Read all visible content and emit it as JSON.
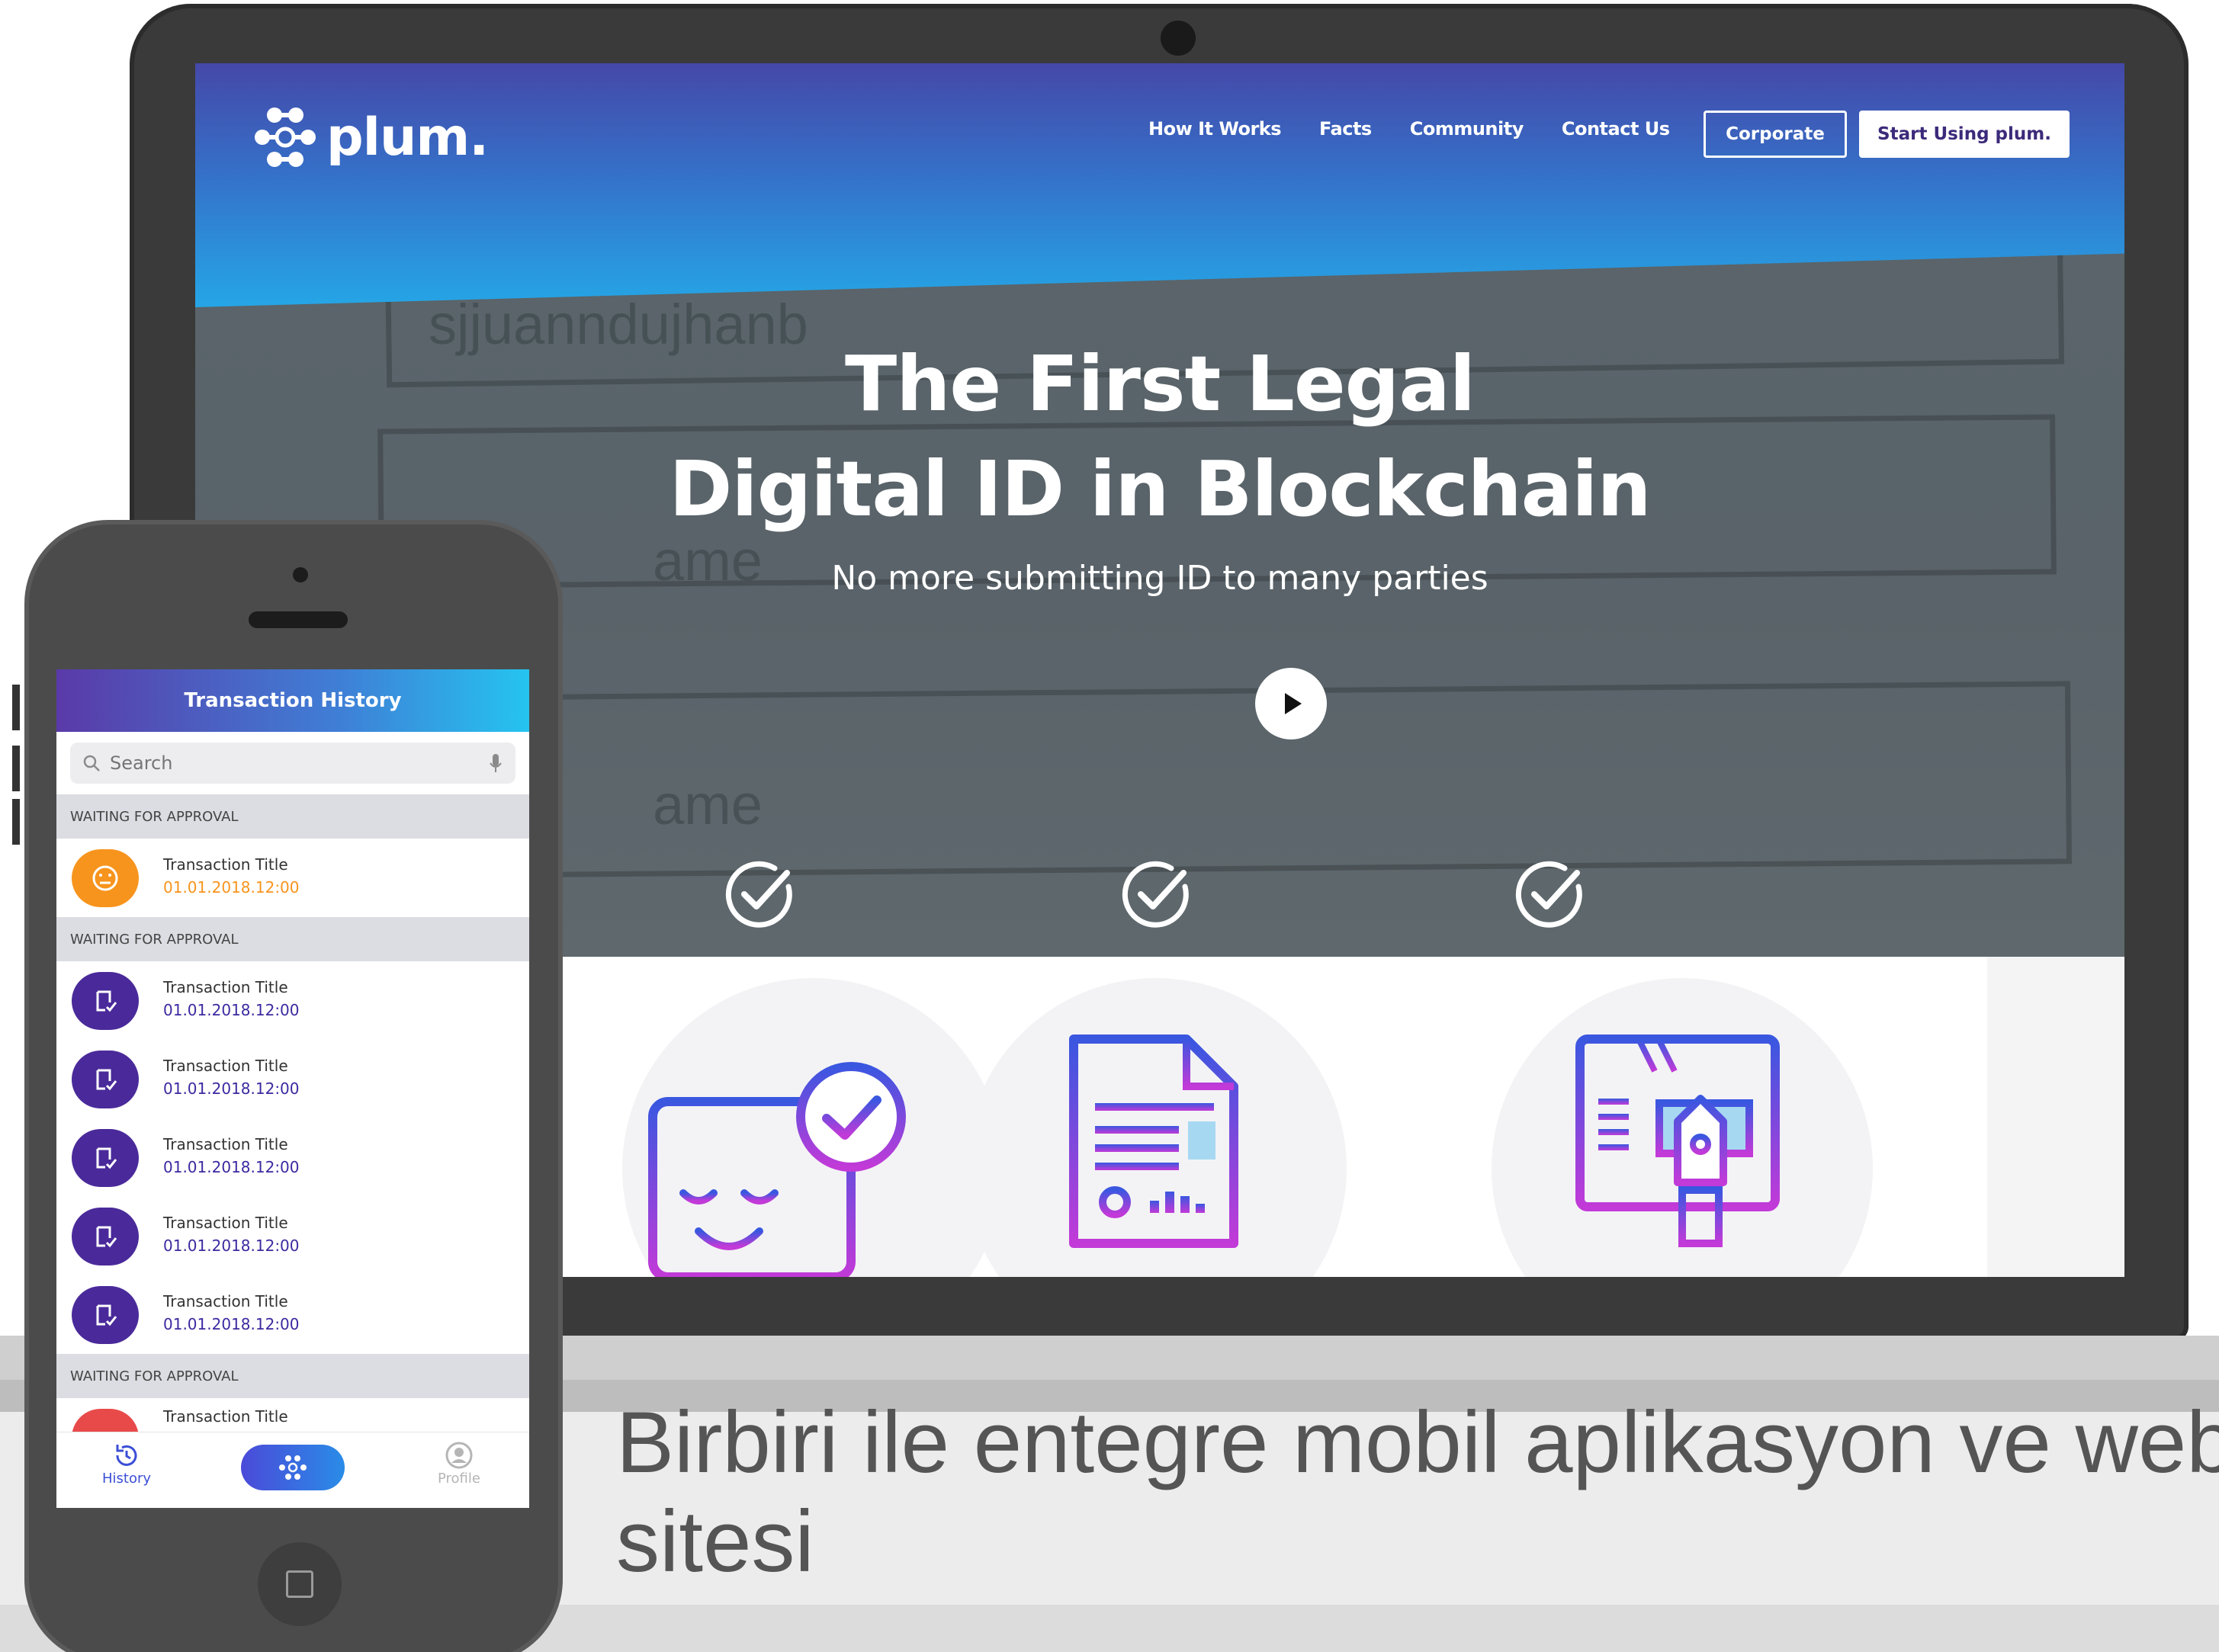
{
  "website": {
    "brand": "plum.",
    "nav": [
      "How It Works",
      "Facts",
      "Community",
      "Contact Us"
    ],
    "corporate_label": "Corporate",
    "start_label": "Start Using plum.",
    "hero": {
      "title_line1": "The First Legal",
      "title_line2": "Digital ID in Blockchain",
      "subtitle": "No more submitting ID to many parties"
    },
    "background_form_words": [
      "sjjuanndujhanb",
      "ame",
      "ame"
    ],
    "colors": {
      "nav_start": "#4548a8",
      "nav_end": "#25a6e6",
      "brand_purple": "#3c2a7a"
    },
    "icons": [
      "play-icon",
      "check-circle-icon",
      "check-circle-icon",
      "check-circle-icon",
      "verified-face-icon",
      "document-icon",
      "certificate-pen-icon"
    ]
  },
  "app": {
    "header_title": "Transaction History",
    "search_placeholder": "Search",
    "sections": [
      {
        "label": "WAITING FOR APPROVAL"
      },
      {
        "label": "WAITING FOR APPROVAL"
      },
      {
        "label": "WAITING FOR APPROVAL"
      }
    ],
    "transactions": [
      {
        "title": "Transaction Title",
        "date": "01.01.2018.12:00",
        "status": "pending",
        "color": "#f7941d"
      },
      {
        "title": "Transaction Title",
        "date": "01.01.2018.12:00",
        "status": "approved",
        "color": "#4a2a9a"
      },
      {
        "title": "Transaction Title",
        "date": "01.01.2018.12:00",
        "status": "approved",
        "color": "#4a2a9a"
      },
      {
        "title": "Transaction Title",
        "date": "01.01.2018.12:00",
        "status": "approved",
        "color": "#4a2a9a"
      },
      {
        "title": "Transaction Title",
        "date": "01.01.2018.12:00",
        "status": "approved",
        "color": "#4a2a9a"
      },
      {
        "title": "Transaction Title",
        "date": "01.01.2018.12:00",
        "status": "approved",
        "color": "#4a2a9a"
      },
      {
        "title": "Transaction Title",
        "date": "",
        "status": "rejected",
        "color": "#e84a4a"
      }
    ],
    "tabs": {
      "history": "History",
      "profile": "Profile"
    }
  },
  "caption": "Birbiri ile entegre mobil aplikasyon ve web sitesi"
}
